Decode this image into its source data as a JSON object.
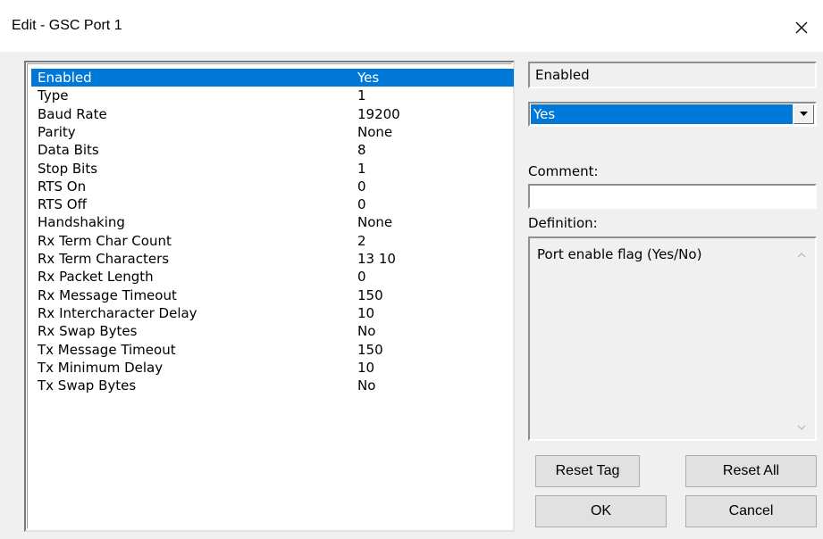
{
  "window": {
    "title": "Edit - GSC Port 1",
    "close_icon": "close-icon"
  },
  "list": {
    "items": [
      {
        "key": "Enabled",
        "value": "Yes",
        "selected": true
      },
      {
        "key": "Type",
        "value": "1"
      },
      {
        "key": "Baud Rate",
        "value": "19200"
      },
      {
        "key": "Parity",
        "value": "None"
      },
      {
        "key": "Data Bits",
        "value": "8"
      },
      {
        "key": "Stop Bits",
        "value": "1"
      },
      {
        "key": "RTS On",
        "value": "0"
      },
      {
        "key": "RTS Off",
        "value": "0"
      },
      {
        "key": "Handshaking",
        "value": "None"
      },
      {
        "key": "Rx Term Char Count",
        "value": "2"
      },
      {
        "key": "Rx Term Characters",
        "value": "13 10"
      },
      {
        "key": "Rx Packet Length",
        "value": "0"
      },
      {
        "key": "Rx Message Timeout",
        "value": "150"
      },
      {
        "key": "Rx Intercharacter Delay",
        "value": "10"
      },
      {
        "key": "Rx Swap Bytes",
        "value": "No"
      },
      {
        "key": "Tx Message Timeout",
        "value": "150"
      },
      {
        "key": "Tx Minimum Delay",
        "value": "10"
      },
      {
        "key": "Tx Swap Bytes",
        "value": "No"
      }
    ]
  },
  "editor": {
    "field_name": "Enabled",
    "selected_value": "Yes",
    "comment_label": "Comment:",
    "comment_value": "",
    "definition_label": "Definition:",
    "definition_text": "Port enable flag (Yes/No)"
  },
  "buttons": {
    "reset_tag": "Reset Tag",
    "reset_all": "Reset All",
    "ok": "OK",
    "cancel": "Cancel"
  },
  "colors": {
    "selection": "#0078d7",
    "dialog_bg": "#f0f0f0"
  }
}
